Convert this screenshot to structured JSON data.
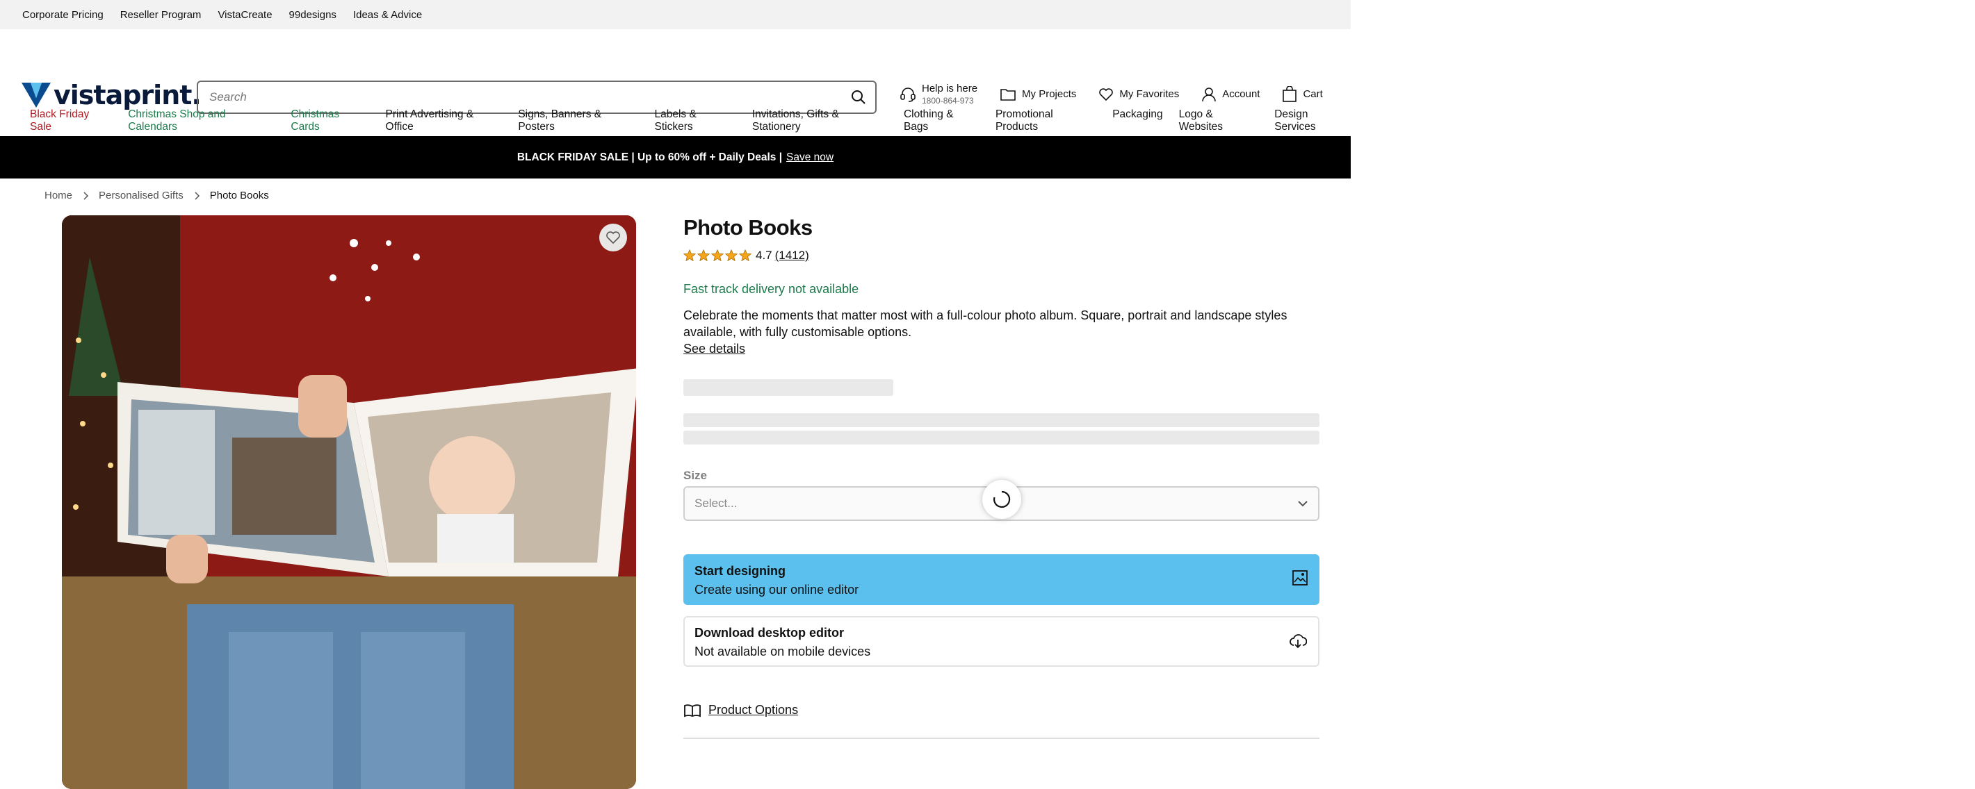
{
  "utility_bar": {
    "links": [
      "Corporate Pricing",
      "Reseller Program",
      "VistaCreate",
      "99designs",
      "Ideas & Advice"
    ]
  },
  "header": {
    "logo_text": "vistaprint.",
    "search_placeholder": "Search",
    "help": {
      "label": "Help is here",
      "phone": "1800-864-973"
    },
    "my_projects": "My Projects",
    "my_favorites": "My Favorites",
    "account": "Account",
    "cart": "Cart"
  },
  "nav": {
    "items": [
      "Black Friday Sale",
      "Christmas Shop and Calendars",
      "Christmas Cards",
      "Print Advertising & Office",
      "Signs, Banners & Posters",
      "Labels & Stickers",
      "Invitations, Gifts & Stationery",
      "Clothing & Bags",
      "Promotional Products",
      "Packaging",
      "Logo & Websites",
      "Design Services"
    ]
  },
  "promo": {
    "text": "BLACK FRIDAY SALE | Up to 60% off + Daily Deals |",
    "link": "Save now"
  },
  "breadcrumb": {
    "items": [
      "Home",
      "Personalised Gifts",
      "Photo Books"
    ]
  },
  "product": {
    "title": "Photo Books",
    "rating": "4.7",
    "review_count": "(1412)",
    "delivery": "Fast track delivery not available",
    "description": "Celebrate the moments that matter most with a full-colour photo album. Square, portrait and landscape styles available, with fully customisable options.",
    "see_details": "See details",
    "size_label": "Size",
    "size_placeholder": "Select...",
    "start_designing": {
      "title": "Start designing",
      "subtitle": "Create using our online editor"
    },
    "download_editor": {
      "title": "Download desktop editor",
      "subtitle": "Not available on mobile devices"
    },
    "product_options": "Product Options"
  },
  "colors": {
    "accent_blue": "#5bc0ee",
    "sale_red": "#b0171f",
    "xmas_green": "#1c7b4b",
    "star_orange": "#f4a51c",
    "promo_bg": "#000000"
  }
}
